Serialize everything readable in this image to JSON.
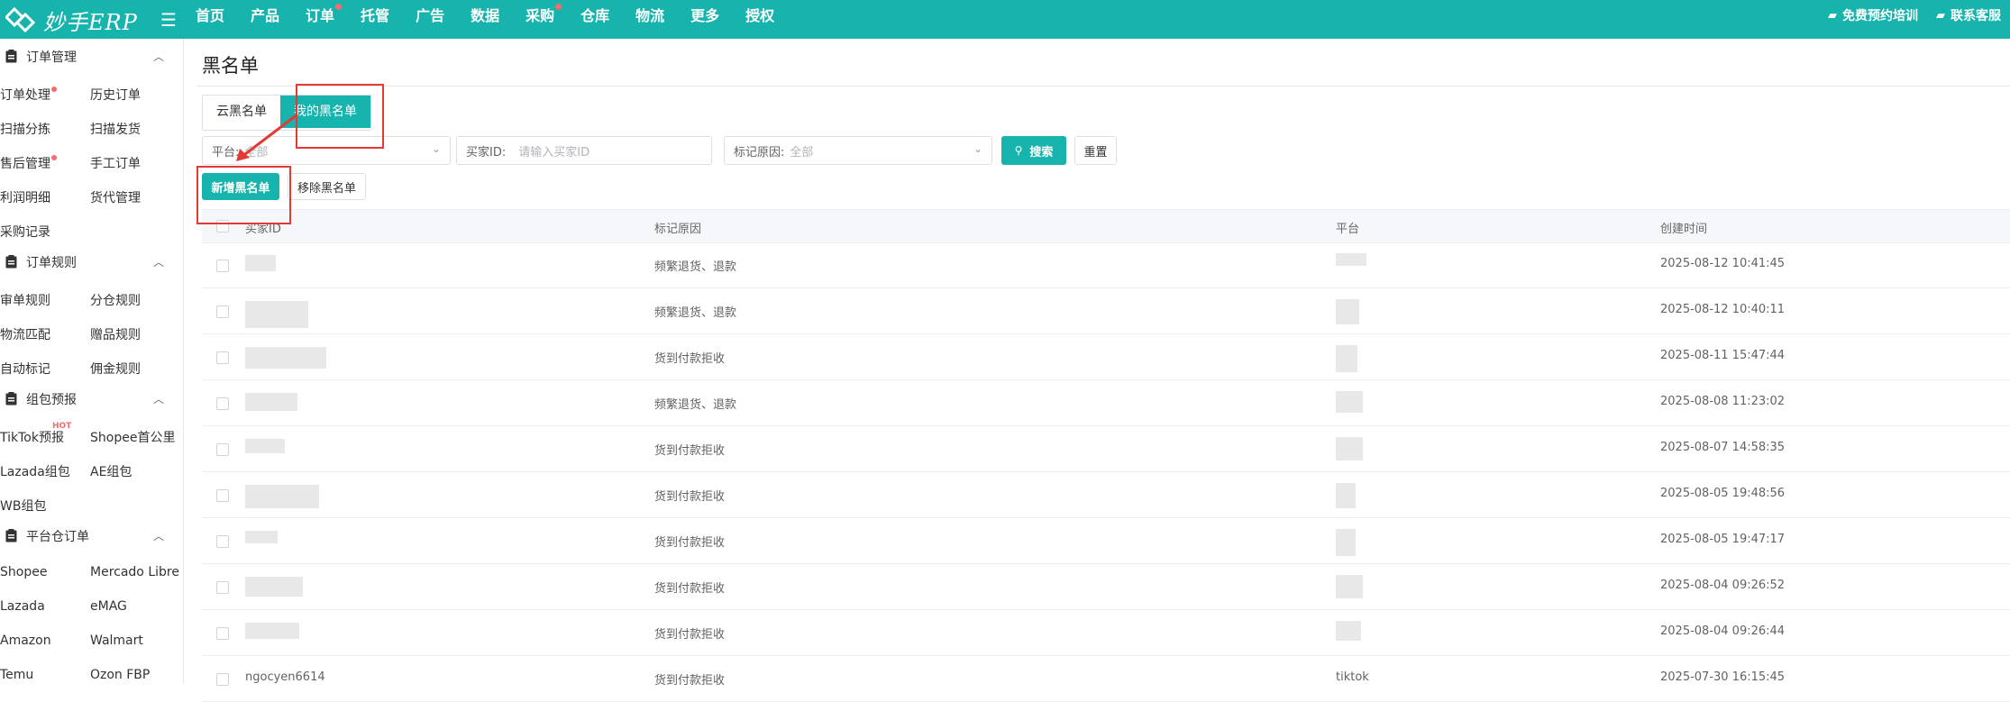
{
  "app": {
    "logo_text": "妙手ERP",
    "accent": "#17b3ad",
    "nav": [
      {
        "label": "首页",
        "dot": false
      },
      {
        "label": "产品",
        "dot": false
      },
      {
        "label": "订单",
        "dot": true
      },
      {
        "label": "托管",
        "dot": false
      },
      {
        "label": "广告",
        "dot": false
      },
      {
        "label": "数据",
        "dot": false
      },
      {
        "label": "采购",
        "dot": true
      },
      {
        "label": "仓库",
        "dot": false
      },
      {
        "label": "物流",
        "dot": false
      },
      {
        "label": "更多",
        "dot": false
      },
      {
        "label": "授权",
        "dot": false
      }
    ],
    "top_right": [
      {
        "icon": "chat-icon",
        "label": "免费预约培训"
      },
      {
        "icon": "service-icon",
        "label": "联系客服"
      }
    ]
  },
  "sidebar": {
    "groups": [
      {
        "title": "订单管理",
        "items": [
          {
            "label": "订单处理",
            "dot": true
          },
          {
            "label": "历史订单"
          },
          {
            "label": "扫描分拣"
          },
          {
            "label": "扫描发货"
          },
          {
            "label": "售后管理",
            "dot": true
          },
          {
            "label": "手工订单"
          },
          {
            "label": "利润明细"
          },
          {
            "label": "货代管理"
          },
          {
            "label": "采购记录"
          }
        ]
      },
      {
        "title": "订单规则",
        "items": [
          {
            "label": "审单规则"
          },
          {
            "label": "分仓规则"
          },
          {
            "label": "物流匹配"
          },
          {
            "label": "赠品规则"
          },
          {
            "label": "自动标记"
          },
          {
            "label": "佣金规则"
          }
        ]
      },
      {
        "title": "组包预报",
        "items": [
          {
            "label": "TikTok预报",
            "badge": "HOT"
          },
          {
            "label": "Shopee首公里"
          },
          {
            "label": "Lazada组包"
          },
          {
            "label": "AE组包"
          },
          {
            "label": "WB组包"
          }
        ]
      },
      {
        "title": "平台仓订单",
        "items": [
          {
            "label": "Shopee"
          },
          {
            "label": "Mercado Libre"
          },
          {
            "label": "Lazada"
          },
          {
            "label": "eMAG"
          },
          {
            "label": "Amazon"
          },
          {
            "label": "Walmart"
          },
          {
            "label": "Temu"
          },
          {
            "label": "Ozon FBP"
          }
        ]
      }
    ]
  },
  "page": {
    "title": "黑名单",
    "tabs": [
      {
        "label": "云黑名单",
        "active": false
      },
      {
        "label": "我的黑名单",
        "active": true
      }
    ],
    "filters": {
      "platform_label": "平台:",
      "platform_value": "全部",
      "buyer_label": "买家ID:",
      "buyer_placeholder": "请输入买家ID",
      "reason_label": "标记原因:",
      "reason_value": "全部",
      "search": "搜索",
      "reset": "重置"
    },
    "actions": {
      "add": "新增黑名单",
      "remove": "移除黑名单"
    },
    "table": {
      "headers": [
        "买家ID",
        "标记原因",
        "平台",
        "创建时间"
      ],
      "rows": [
        {
          "reason": "频繁退货、退款",
          "time": "2025-08-12 10:41:45"
        },
        {
          "reason": "频繁退货、退款",
          "time": "2025-08-12 10:40:11"
        },
        {
          "reason": "货到付款拒收",
          "time": "2025-08-11 15:47:44"
        },
        {
          "reason": "频繁退货、退款",
          "time": "2025-08-08 11:23:02"
        },
        {
          "reason": "货到付款拒收",
          "time": "2025-08-07 14:58:35"
        },
        {
          "reason": "货到付款拒收",
          "time": "2025-08-05 19:48:56"
        },
        {
          "reason": "货到付款拒收",
          "time": "2025-08-05 19:47:17"
        },
        {
          "reason": "货到付款拒收",
          "time": "2025-08-04 09:26:52"
        },
        {
          "reason": "货到付款拒收",
          "time": "2025-08-04 09:26:44"
        },
        {
          "buyer": "ngocyen6614",
          "reason": "货到付款拒收",
          "platform": "tiktok",
          "time": "2025-07-30 16:15:45"
        }
      ]
    }
  }
}
